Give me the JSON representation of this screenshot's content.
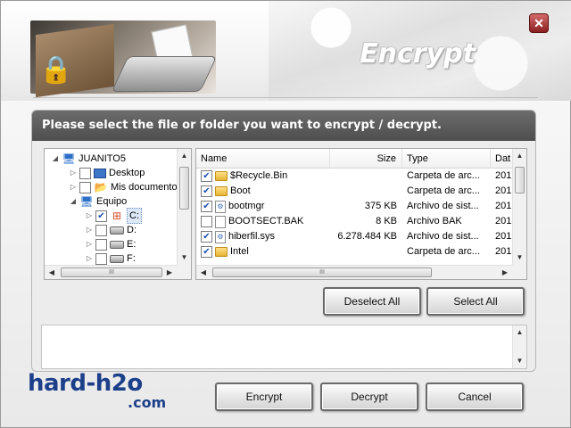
{
  "window": {
    "title": "Encrypt",
    "close_icon": "close-icon"
  },
  "panel": {
    "instruction": "Please select the file or folder you want to encrypt / decrypt."
  },
  "tree": {
    "items": [
      {
        "label": "JUANITO5",
        "icon": "computer-icon",
        "expanded": true,
        "checked": false
      },
      {
        "label": "Desktop",
        "icon": "desktop-icon",
        "expanded": false,
        "checked": false
      },
      {
        "label": "Mis documentos",
        "icon": "documents-icon",
        "expanded": false,
        "checked": false
      },
      {
        "label": "Equipo",
        "icon": "computer-icon",
        "expanded": true,
        "checked": false
      },
      {
        "label": "C:",
        "icon": "windows-drive-icon",
        "expanded": false,
        "checked": true,
        "selected": true
      },
      {
        "label": "D:",
        "icon": "drive-icon",
        "expanded": false,
        "checked": false
      },
      {
        "label": "E:",
        "icon": "drive-icon",
        "expanded": false,
        "checked": false
      },
      {
        "label": "F:",
        "icon": "drive-icon",
        "expanded": false,
        "checked": false
      }
    ],
    "hscroll_grip": "III"
  },
  "list": {
    "columns": [
      "Name",
      "Size",
      "Type",
      "Dat"
    ],
    "rows": [
      {
        "checked": true,
        "icon": "folder-icon",
        "name": "$Recycle.Bin",
        "size": "",
        "type": "Carpeta de arc...",
        "date": "201"
      },
      {
        "checked": true,
        "icon": "folder-icon",
        "name": "Boot",
        "size": "",
        "type": "Carpeta de arc...",
        "date": "201"
      },
      {
        "checked": true,
        "icon": "system-file-icon",
        "name": "bootmgr",
        "size": "375 KB",
        "type": "Archivo de sist...",
        "date": "201"
      },
      {
        "checked": false,
        "icon": "file-icon",
        "name": "BOOTSECT.BAK",
        "size": "8 KB",
        "type": "Archivo BAK",
        "date": "201"
      },
      {
        "checked": true,
        "icon": "system-file-icon",
        "name": "hiberfil.sys",
        "size": "6.278.484 KB",
        "type": "Archivo de sist...",
        "date": "201"
      },
      {
        "checked": true,
        "icon": "folder-icon",
        "name": "Intel",
        "size": "",
        "type": "Carpeta de arc...",
        "date": "201"
      }
    ],
    "hscroll_grip": "III"
  },
  "buttons": {
    "deselect_all": "Deselect All",
    "select_all": "Select All",
    "encrypt": "Encrypt",
    "decrypt": "Decrypt",
    "cancel": "Cancel"
  },
  "brand": {
    "name": "hard-h2o",
    "suffix": ".com",
    "color": "#1c3f8a"
  },
  "colors": {
    "panel_bar": "#5a5a5a",
    "check": "#1c4fb4",
    "close_button": "#a52a2a"
  }
}
